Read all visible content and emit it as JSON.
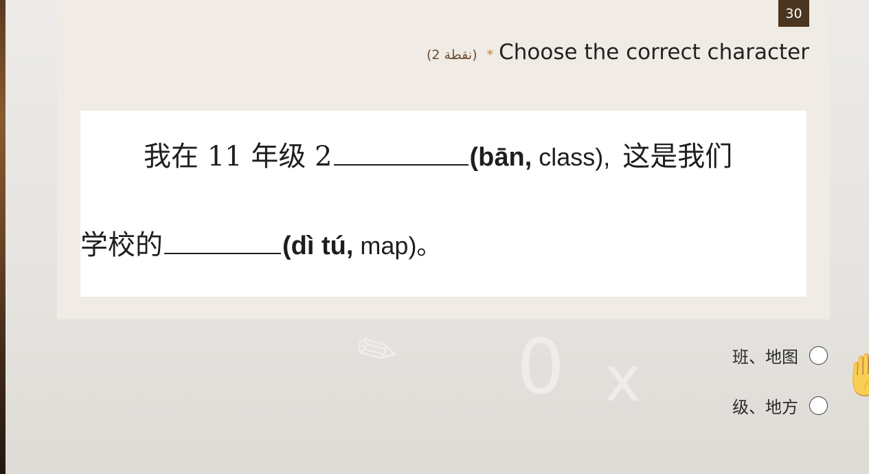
{
  "question": {
    "number": "30",
    "title": "Choose the correct character",
    "required_mark": "*",
    "points": "(2 نقطة)"
  },
  "image": {
    "line1_start": "我在 11 年级 2",
    "line1_pinyin_bold": "(bān,",
    "line1_pinyin_light": " class),",
    "line1_end": "这是我们",
    "line2_start": "学校的",
    "line2_pinyin_bold": "(dì  tú,",
    "line2_pinyin_light": " map)。"
  },
  "options": [
    {
      "label": "班、地图"
    },
    {
      "label": "级、地方"
    }
  ],
  "colors": {
    "card_bg": "#f0ebe5",
    "badge_bg": "#4a3520",
    "required_star": "#b8862e",
    "points_text": "#6a4e33"
  }
}
